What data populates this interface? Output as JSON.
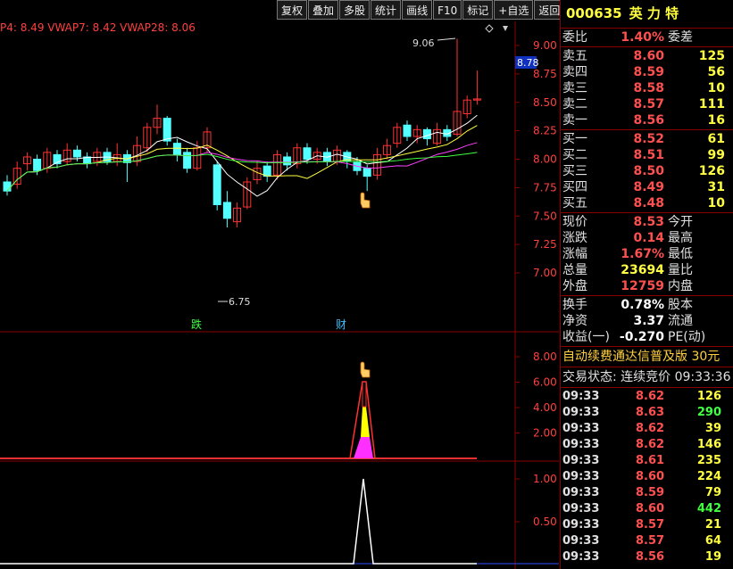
{
  "toolbar": {
    "buttons": [
      "复权",
      "叠加",
      "多股",
      "统计",
      "画线",
      "F10",
      "标记",
      "+自选",
      "返回"
    ]
  },
  "vwap_legend": "P4: 8.49  VWAP7: 8.42  VWAP28: 8.06",
  "price_axis": {
    "ticks": [
      "9.00",
      "8.75",
      "8.50",
      "8.25",
      "8.00",
      "7.75",
      "7.50",
      "7.25",
      "7.00"
    ],
    "current_price_tag": "8.78",
    "high_label": "9.06",
    "low_label": "6.75"
  },
  "event_markers": {
    "fall": "跌",
    "fin": "财"
  },
  "indicator1_axis": [
    "8.00",
    "6.00",
    "4.00",
    "2.00"
  ],
  "indicator2_axis": [
    "1.00",
    "0.50"
  ],
  "candles": [
    {
      "o": 7.8,
      "c": 7.72,
      "h": 7.86,
      "l": 7.68
    },
    {
      "o": 7.78,
      "c": 7.92,
      "h": 7.98,
      "l": 7.74
    },
    {
      "o": 7.96,
      "c": 8.02,
      "h": 8.06,
      "l": 7.9
    },
    {
      "o": 8.0,
      "c": 7.9,
      "h": 8.04,
      "l": 7.86
    },
    {
      "o": 7.92,
      "c": 8.06,
      "h": 8.1,
      "l": 7.88
    },
    {
      "o": 8.04,
      "c": 7.96,
      "h": 8.08,
      "l": 7.92
    },
    {
      "o": 7.98,
      "c": 8.08,
      "h": 8.14,
      "l": 7.95
    },
    {
      "o": 8.08,
      "c": 8.02,
      "h": 8.12,
      "l": 7.98
    },
    {
      "o": 8.02,
      "c": 7.96,
      "h": 8.06,
      "l": 7.92
    },
    {
      "o": 7.98,
      "c": 8.06,
      "h": 8.1,
      "l": 7.94
    },
    {
      "o": 8.06,
      "c": 7.98,
      "h": 8.1,
      "l": 7.95
    },
    {
      "o": 7.98,
      "c": 8.04,
      "h": 8.14,
      "l": 7.94
    },
    {
      "o": 8.04,
      "c": 7.97,
      "h": 8.08,
      "l": 7.8
    },
    {
      "o": 7.98,
      "c": 8.12,
      "h": 8.2,
      "l": 7.94
    },
    {
      "o": 8.1,
      "c": 8.28,
      "h": 8.32,
      "l": 8.06
    },
    {
      "o": 8.28,
      "c": 8.36,
      "h": 8.48,
      "l": 8.22
    },
    {
      "o": 8.36,
      "c": 8.16,
      "h": 8.38,
      "l": 8.12
    },
    {
      "o": 8.14,
      "c": 8.04,
      "h": 8.18,
      "l": 7.98
    },
    {
      "o": 8.06,
      "c": 7.92,
      "h": 8.1,
      "l": 7.88
    },
    {
      "o": 7.92,
      "c": 8.1,
      "h": 8.16,
      "l": 7.9
    },
    {
      "o": 8.1,
      "c": 8.24,
      "h": 8.28,
      "l": 8.06
    },
    {
      "o": 7.95,
      "c": 7.6,
      "h": 7.98,
      "l": 7.55
    },
    {
      "o": 7.62,
      "c": 7.48,
      "h": 7.72,
      "l": 7.4
    },
    {
      "o": 7.45,
      "c": 7.57,
      "h": 7.62,
      "l": 7.4
    },
    {
      "o": 7.58,
      "c": 7.8,
      "h": 7.84,
      "l": 7.56
    },
    {
      "o": 7.82,
      "c": 7.92,
      "h": 7.98,
      "l": 7.78
    },
    {
      "o": 7.94,
      "c": 7.85,
      "h": 7.98,
      "l": 7.8
    },
    {
      "o": 7.86,
      "c": 8.04,
      "h": 8.08,
      "l": 7.82
    },
    {
      "o": 8.02,
      "c": 7.95,
      "h": 8.06,
      "l": 7.9
    },
    {
      "o": 7.96,
      "c": 8.1,
      "h": 8.14,
      "l": 7.92
    },
    {
      "o": 8.1,
      "c": 8.0,
      "h": 8.14,
      "l": 7.96
    },
    {
      "o": 8.0,
      "c": 8.06,
      "h": 8.1,
      "l": 7.96
    },
    {
      "o": 8.06,
      "c": 7.98,
      "h": 8.1,
      "l": 7.94
    },
    {
      "o": 7.98,
      "c": 8.08,
      "h": 8.12,
      "l": 7.95
    },
    {
      "o": 8.06,
      "c": 7.98,
      "h": 8.08,
      "l": 7.92
    },
    {
      "o": 7.98,
      "c": 7.9,
      "h": 8.02,
      "l": 7.86
    },
    {
      "o": 7.92,
      "c": 7.85,
      "h": 7.95,
      "l": 7.72
    },
    {
      "o": 7.86,
      "c": 8.04,
      "h": 8.1,
      "l": 7.82
    },
    {
      "o": 8.04,
      "c": 8.12,
      "h": 8.18,
      "l": 8.0
    },
    {
      "o": 8.14,
      "c": 8.28,
      "h": 8.32,
      "l": 8.1
    },
    {
      "o": 8.3,
      "c": 8.2,
      "h": 8.34,
      "l": 8.16
    },
    {
      "o": 8.2,
      "c": 8.26,
      "h": 8.3,
      "l": 8.14
    },
    {
      "o": 8.26,
      "c": 8.18,
      "h": 8.28,
      "l": 8.12
    },
    {
      "o": 8.14,
      "c": 8.26,
      "h": 8.32,
      "l": 8.12
    },
    {
      "o": 8.26,
      "c": 8.2,
      "h": 8.3,
      "l": 8.16
    },
    {
      "o": 8.22,
      "c": 8.42,
      "h": 9.06,
      "l": 8.2
    },
    {
      "o": 8.4,
      "c": 8.52,
      "h": 8.56,
      "l": 8.36
    },
    {
      "o": 8.52,
      "c": 8.53,
      "h": 8.78,
      "l": 8.48
    }
  ],
  "quote": {
    "code": "000635",
    "name": "英 力 特",
    "weibi_label": "委比",
    "weibi_value": "1.40%",
    "weicha_label": "委差",
    "asks": [
      {
        "label": "卖五",
        "price": "8.60",
        "vol": "125"
      },
      {
        "label": "卖四",
        "price": "8.59",
        "vol": "56"
      },
      {
        "label": "卖三",
        "price": "8.58",
        "vol": "10"
      },
      {
        "label": "卖二",
        "price": "8.57",
        "vol": "111"
      },
      {
        "label": "卖一",
        "price": "8.56",
        "vol": "16"
      }
    ],
    "bids": [
      {
        "label": "买一",
        "price": "8.52",
        "vol": "61"
      },
      {
        "label": "买二",
        "price": "8.51",
        "vol": "99"
      },
      {
        "label": "买三",
        "price": "8.50",
        "vol": "126"
      },
      {
        "label": "买四",
        "price": "8.49",
        "vol": "31"
      },
      {
        "label": "买五",
        "price": "8.48",
        "vol": "10"
      }
    ],
    "stats": [
      {
        "l": "现价",
        "v": "8.53",
        "l2": "今开"
      },
      {
        "l": "涨跌",
        "v": "0.14",
        "l2": "最高"
      },
      {
        "l": "涨幅",
        "v": "1.67%",
        "l2": "最低"
      },
      {
        "l": "总量",
        "v": "23694",
        "l2": "量比"
      },
      {
        "l": "外盘",
        "v": "12759",
        "l2": "内盘"
      }
    ],
    "stats2": [
      {
        "l": "换手",
        "v": "0.78%",
        "l2": "股本"
      },
      {
        "l": "净资",
        "v": "3.37",
        "l2": "流通"
      },
      {
        "l": "收益(一)",
        "v": "-0.270",
        "l2": "PE(动)"
      }
    ],
    "banner": "自动续费通达信普及版 30元",
    "status": "交易状态: 连续竞价 09:33:36",
    "ticks": [
      {
        "t": "09:33",
        "p": "8.62",
        "v": "126"
      },
      {
        "t": "09:33",
        "p": "8.63",
        "v": "290"
      },
      {
        "t": "09:33",
        "p": "8.62",
        "v": "39"
      },
      {
        "t": "09:33",
        "p": "8.62",
        "v": "146"
      },
      {
        "t": "09:33",
        "p": "8.61",
        "v": "235"
      },
      {
        "t": "09:33",
        "p": "8.60",
        "v": "224"
      },
      {
        "t": "09:33",
        "p": "8.59",
        "v": "79"
      },
      {
        "t": "09:33",
        "p": "8.60",
        "v": "442"
      },
      {
        "t": "09:33",
        "p": "8.57",
        "v": "21"
      },
      {
        "t": "09:33",
        "p": "8.57",
        "v": "64"
      },
      {
        "t": "09:33",
        "p": "8.56",
        "v": "19"
      }
    ]
  },
  "colors": {
    "up": "#ff3333",
    "down": "#54ffff",
    "grid": "#8a0000",
    "ma5": "#ffffff",
    "ma10": "#ffff40",
    "ma20": "#ff40ff",
    "ma60": "#40ff40"
  }
}
